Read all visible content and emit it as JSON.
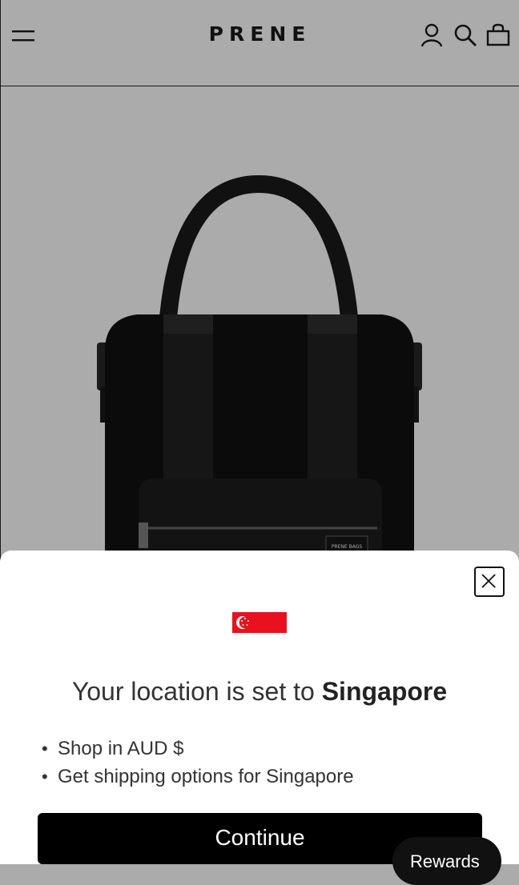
{
  "header": {
    "logo": "PRENE",
    "icons": [
      "menu-icon",
      "account-icon",
      "search-icon",
      "bag-icon"
    ]
  },
  "product": {
    "bag_tag": "PRENE BAGS"
  },
  "modal": {
    "flag_icon": "singapore-flag-icon",
    "title_prefix": "Your location is set to ",
    "title_country": "Singapore",
    "bullets": [
      "Shop in AUD $",
      "Get shipping options for Singapore"
    ],
    "continue_label": "Continue"
  },
  "rewards_label": "Rewards",
  "colors": {
    "background": "#ababab",
    "primary": "#000000",
    "flag_red": "#e8111d"
  }
}
